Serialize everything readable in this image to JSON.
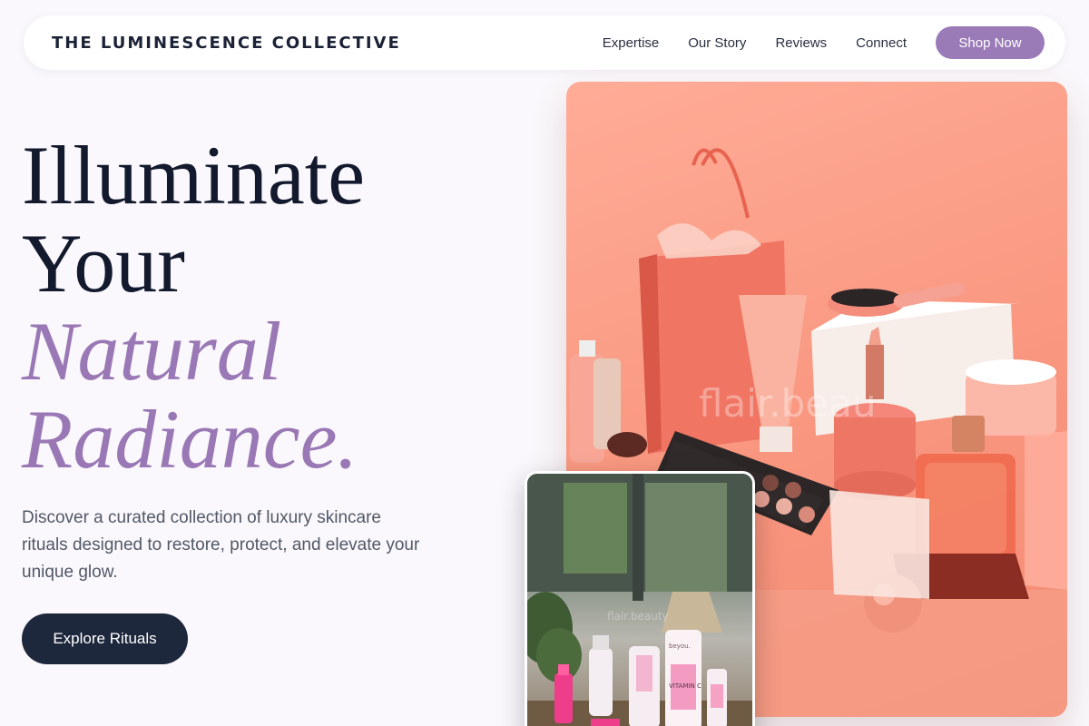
{
  "brand": "THE LUMINESCENCE COLLECTIVE",
  "nav": {
    "links": [
      "Expertise",
      "Our Story",
      "Reviews",
      "Connect"
    ],
    "cta": "Shop Now"
  },
  "hero": {
    "headline_line1": "Illuminate",
    "headline_line2": "Your",
    "headline_accent_line1": "Natural",
    "headline_accent_line2": "Radiance.",
    "description": "Discover a curated collection of luxury skincare rituals designed to restore, protect, and elevate your unique glow.",
    "cta": "Explore Rituals"
  },
  "images": {
    "main_watermark": "flair.beau",
    "secondary_watermark": "flair.beauty",
    "secondary_label_brand": "beyou.",
    "secondary_label_product": "VITAMIN C"
  },
  "colors": {
    "accent": "#9a7bb8",
    "dark": "#1e283d",
    "background": "#faf8fc",
    "coral": "#f9967f"
  }
}
